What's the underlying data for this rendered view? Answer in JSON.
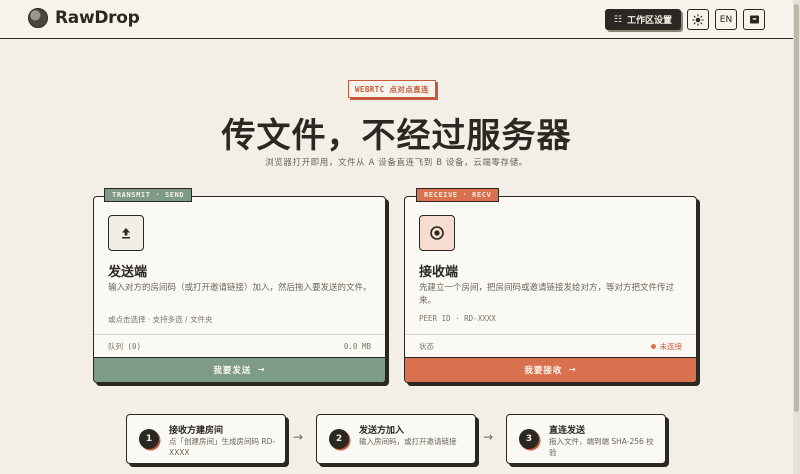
{
  "brand": {
    "name": "RawDrop"
  },
  "header": {
    "workspace_label": "工作区设置",
    "theme_icon": "sun-icon",
    "lang_label": "EN",
    "extra_icon": "box-icon"
  },
  "hero": {
    "eyebrow": "WEBRTC 点对点直连",
    "title": "传文件，不经过服务器",
    "subtitle": "浏览器打开即用，文件从 A 设备直连飞到 B 设备，云端零存储。"
  },
  "send_card": {
    "tag": "TRANSMIT · SEND",
    "icon": "upload-icon",
    "title": "发送端",
    "description": "输入对方的房间码（或打开邀请链接）加入，然后拖入要发送的文件。",
    "hint": "或点击选择 · 支持多选 / 文件夹",
    "meta_left": "队列 (0)",
    "meta_right": "0.0 MB",
    "action": "我要发送",
    "action_arrow": "→"
  },
  "recv_card": {
    "tag": "RECEIVE · RECV",
    "icon": "target-icon",
    "title": "接收端",
    "description": "先建立一个房间，把房间码或邀请链接发给对方，等对方把文件传过来。",
    "hint": "PEER ID · RD-XXXX",
    "meta_left": "状态",
    "meta_right": "未连接",
    "action": "我要接收",
    "action_arrow": "→",
    "status_color": "#d9714f"
  },
  "steps": [
    {
      "num": "1",
      "title": "接收方建房间",
      "desc": "点「创建房间」生成房间码 RD-XXXX"
    },
    {
      "num": "2",
      "title": "发送方加入",
      "desc": "输入房间码，或打开邀请链接"
    },
    {
      "num": "3",
      "title": "直连发送",
      "desc": "拖入文件，端到端 SHA-256 校验"
    }
  ],
  "step_arrow": "→",
  "colors": {
    "accent": "#c65a3a",
    "send": "#7e9a88",
    "recv": "#d9714f",
    "ink": "#2b2722",
    "paper": "#f3efe6"
  }
}
